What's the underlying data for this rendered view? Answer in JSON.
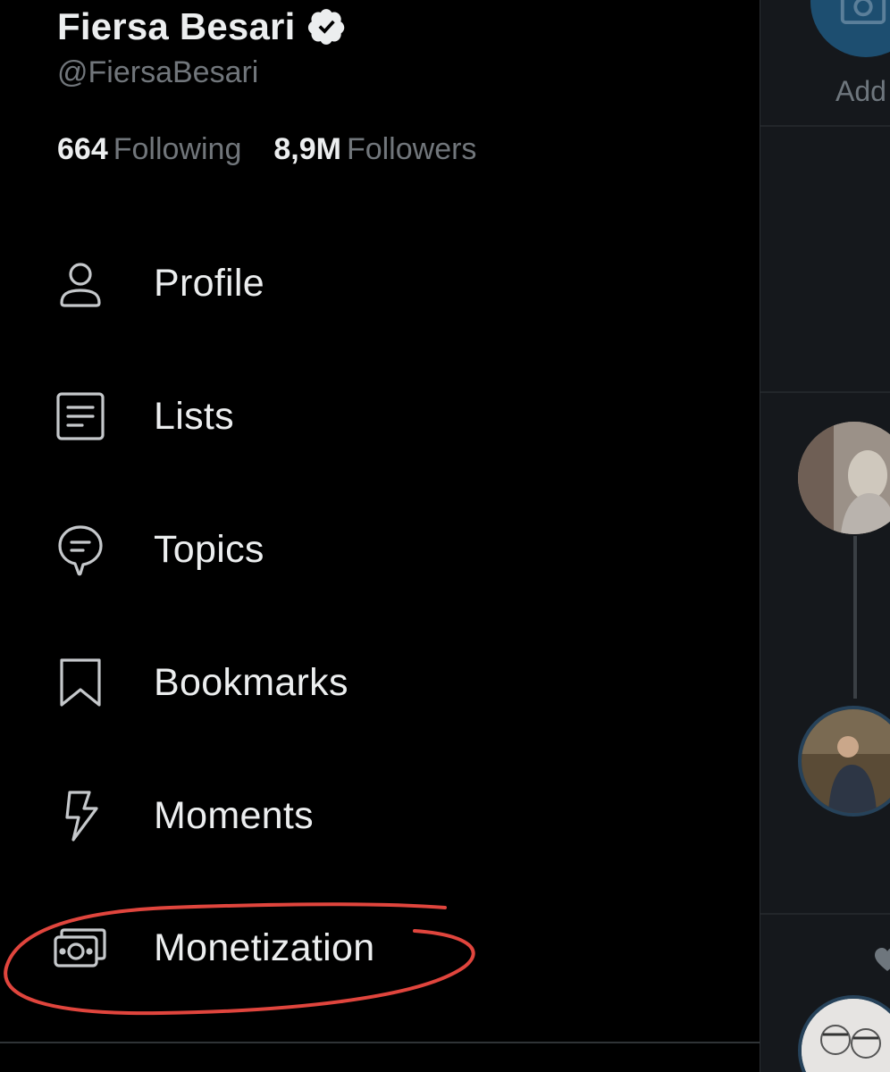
{
  "profile": {
    "display_name": "Fiersa Besari",
    "handle": "@FiersaBesari",
    "following_count": "664",
    "following_label": "Following",
    "followers_count": "8,9M",
    "followers_label": "Followers"
  },
  "menu": {
    "items": [
      {
        "label": "Profile",
        "icon": "person-icon"
      },
      {
        "label": "Lists",
        "icon": "list-icon"
      },
      {
        "label": "Topics",
        "icon": "topics-bubble-icon"
      },
      {
        "label": "Bookmarks",
        "icon": "bookmark-icon"
      },
      {
        "label": "Moments",
        "icon": "lightning-icon"
      },
      {
        "label": "Monetization",
        "icon": "money-icon"
      }
    ]
  },
  "right_pane": {
    "add_label": "Add"
  },
  "colors": {
    "background": "#000000",
    "text_primary": "#eceeef",
    "text_secondary": "#71767b",
    "annotation_red": "#e0453d",
    "right_pane_bg": "#15181c",
    "accent_blue": "#1d4e70"
  }
}
